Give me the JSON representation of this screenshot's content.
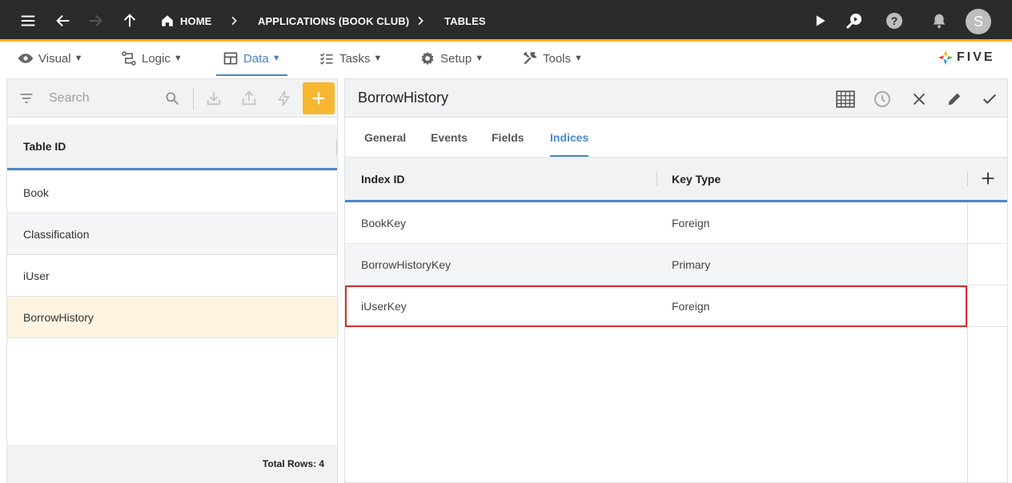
{
  "topbar": {
    "breadcrumbs": [
      {
        "label": "HOME"
      },
      {
        "label": "APPLICATIONS (BOOK CLUB)"
      },
      {
        "label": "TABLES"
      }
    ],
    "user_initial": "S",
    "bar_color": "#2b2b2b",
    "accent_color": "#f7b500"
  },
  "menu": {
    "items": [
      {
        "label": "Visual",
        "icon": "eye-icon"
      },
      {
        "label": "Logic",
        "icon": "logic-icon"
      },
      {
        "label": "Data",
        "icon": "table-icon",
        "active": true
      },
      {
        "label": "Tasks",
        "icon": "checklist-icon"
      },
      {
        "label": "Setup",
        "icon": "gear-icon"
      },
      {
        "label": "Tools",
        "icon": "wrench-icon"
      }
    ],
    "caret": "▼",
    "logo_text": "FIVE"
  },
  "left_panel": {
    "search_placeholder": "Search",
    "column_header": "Table ID",
    "rows": [
      {
        "label": "Book"
      },
      {
        "label": "Classification"
      },
      {
        "label": "iUser"
      },
      {
        "label": "BorrowHistory",
        "selected": true
      }
    ],
    "footer": "Total Rows: 4"
  },
  "right_panel": {
    "title": "BorrowHistory",
    "tabs": [
      {
        "label": "General"
      },
      {
        "label": "Events"
      },
      {
        "label": "Fields"
      },
      {
        "label": "Indices",
        "active": true
      }
    ],
    "columns": [
      "Index ID",
      "Key Type"
    ],
    "rows": [
      {
        "index_id": "BookKey",
        "key_type": "Foreign"
      },
      {
        "index_id": "BorrowHistoryKey",
        "key_type": "Primary"
      },
      {
        "index_id": "iUserKey",
        "key_type": "Foreign",
        "highlighted": true
      }
    ]
  },
  "colors": {
    "accent_blue": "#4a86c7",
    "add_button": "#f7b731",
    "highlight_border": "#d32f2f",
    "selected_row": "#fff4e2"
  }
}
